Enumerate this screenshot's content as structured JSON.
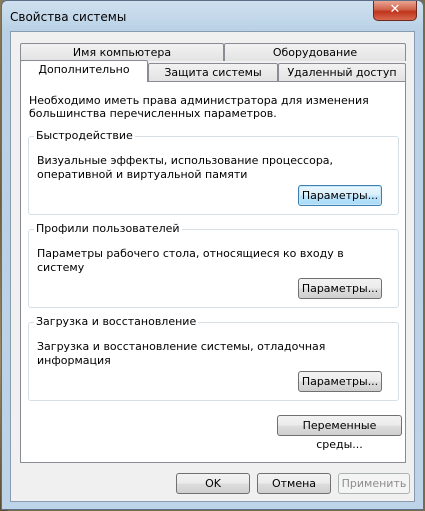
{
  "window": {
    "title": "Свойства системы",
    "close_symbol": "✕"
  },
  "tabs": {
    "row1": [
      "Имя компьютера",
      "Оборудование"
    ],
    "row2": [
      "Дополнительно",
      "Защита системы",
      "Удаленный доступ"
    ]
  },
  "panel": {
    "intro": "Необходимо иметь права администратора для изменения большинства перечисленных параметров.",
    "performance": {
      "title": "Быстродействие",
      "desc": "Визуальные эффекты, использование процессора, оперативной и виртуальной памяти",
      "button": "Параметры..."
    },
    "profiles": {
      "title": "Профили пользователей",
      "desc": "Параметры рабочего стола, относящиеся ко входу в систему",
      "button": "Параметры..."
    },
    "startup": {
      "title": "Загрузка и восстановление",
      "desc": "Загрузка и восстановление системы, отладочная информация",
      "button": "Параметры..."
    },
    "env_button": "Переменные среды..."
  },
  "footer": {
    "ok": "OK",
    "cancel": "Отмена",
    "apply": "Применить"
  }
}
